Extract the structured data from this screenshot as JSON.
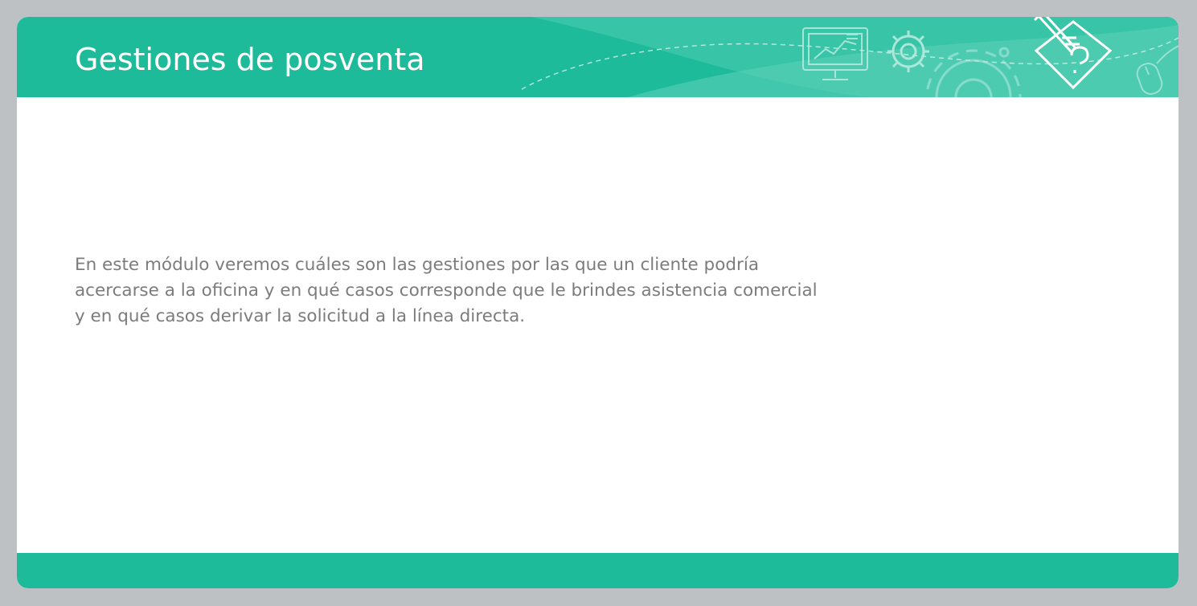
{
  "slide": {
    "title": "Gestiones de posventa",
    "body_text": "En este módulo veremos cuáles son las gestiones por las que un cliente podría\nacercarse a la oficina y en qué casos corresponde que le brindes asistencia comercial\ny en qué casos derivar la solicitud a la línea directa."
  },
  "header_icons": [
    "monitor-chart-icon",
    "gear-icon",
    "large-gear-icon",
    "checklist-pencil-icon",
    "computer-mouse-icon"
  ],
  "colors": {
    "background": "#bdc1c4",
    "accent": "#1dbb9a",
    "accent_light": "#4ecbb0",
    "text": "#7c7c7c",
    "title": "#ffffff"
  }
}
